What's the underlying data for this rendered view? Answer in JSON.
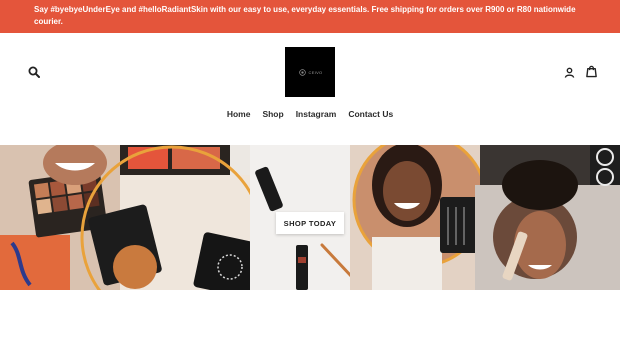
{
  "announcement": {
    "text": "Say #byebyeUnderEye and #helloRadiantSkin with our easy to use, everyday essentials. Free shipping for orders over R900 or R80 nationwide courier."
  },
  "header": {
    "logo_text": "CEIVO",
    "icons": {
      "search": "search-icon",
      "account": "user-icon",
      "cart": "cart-icon"
    }
  },
  "nav": {
    "items": [
      {
        "label": "Home"
      },
      {
        "label": "Shop"
      },
      {
        "label": "Instagram"
      },
      {
        "label": "Contact Us"
      }
    ]
  },
  "hero": {
    "cta_label": "SHOP TODAY"
  },
  "colors": {
    "announcement_bg": "#e4553b",
    "logo_bg": "#000000"
  }
}
